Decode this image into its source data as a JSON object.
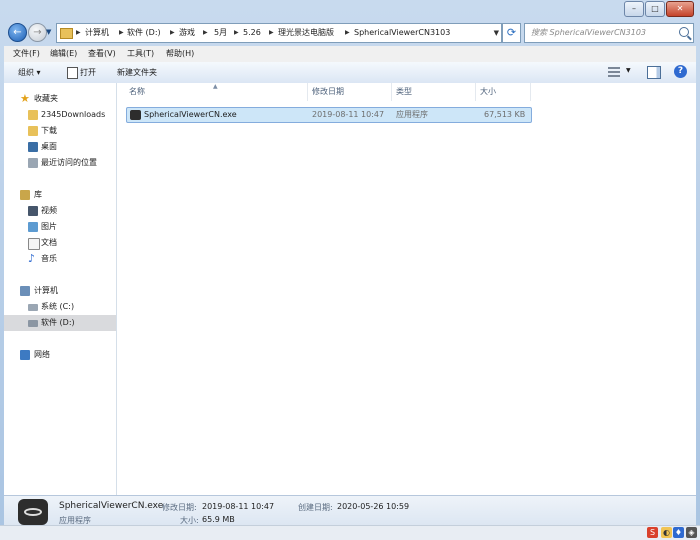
{
  "nav": {
    "address_crumbs": [
      "计算机",
      "软件 (D:)",
      "游戏",
      "5月",
      "5.26",
      "理光景达电脑版",
      "SphericalViewerCN3103"
    ],
    "search_placeholder": "搜索 SphericalViewerCN3103"
  },
  "menubar": [
    "文件(F)",
    "编辑(E)",
    "查看(V)",
    "工具(T)",
    "帮助(H)"
  ],
  "toolbar": {
    "organize": "组织 ▾",
    "open": "打开",
    "new_folder": "新建文件夹"
  },
  "sidebar": {
    "favorites_title": "收藏夹",
    "favorites": [
      "2345Downloads",
      "下载",
      "桌面",
      "最近访问的位置"
    ],
    "libraries_title": "库",
    "libraries": [
      "视频",
      "图片",
      "文档",
      "音乐"
    ],
    "computer_title": "计算机",
    "computer": [
      "系统 (C:)",
      "软件 (D:)"
    ],
    "network_title": "网络"
  },
  "columns": [
    "名称",
    "修改日期",
    "类型",
    "大小"
  ],
  "files": [
    {
      "name": "SphericalViewerCN.exe",
      "modified": "2019-08-11 10:47",
      "type": "应用程序",
      "size": "67,513 KB"
    }
  ],
  "status": {
    "filename": "SphericalViewerCN.exe",
    "modified_label": "修改日期:",
    "modified_value": "2019-08-11 10:47",
    "created_label": "创建日期:",
    "created_value": "2020-05-26 10:59",
    "type_value": "应用程序",
    "size_label": "大小:",
    "size_value": "65.9 MB"
  },
  "colors": {
    "accent": "#1c5fb5",
    "selection": "#cde6f8",
    "tray_s": "#d9402b",
    "tray_blue": "#2f6ad0"
  }
}
